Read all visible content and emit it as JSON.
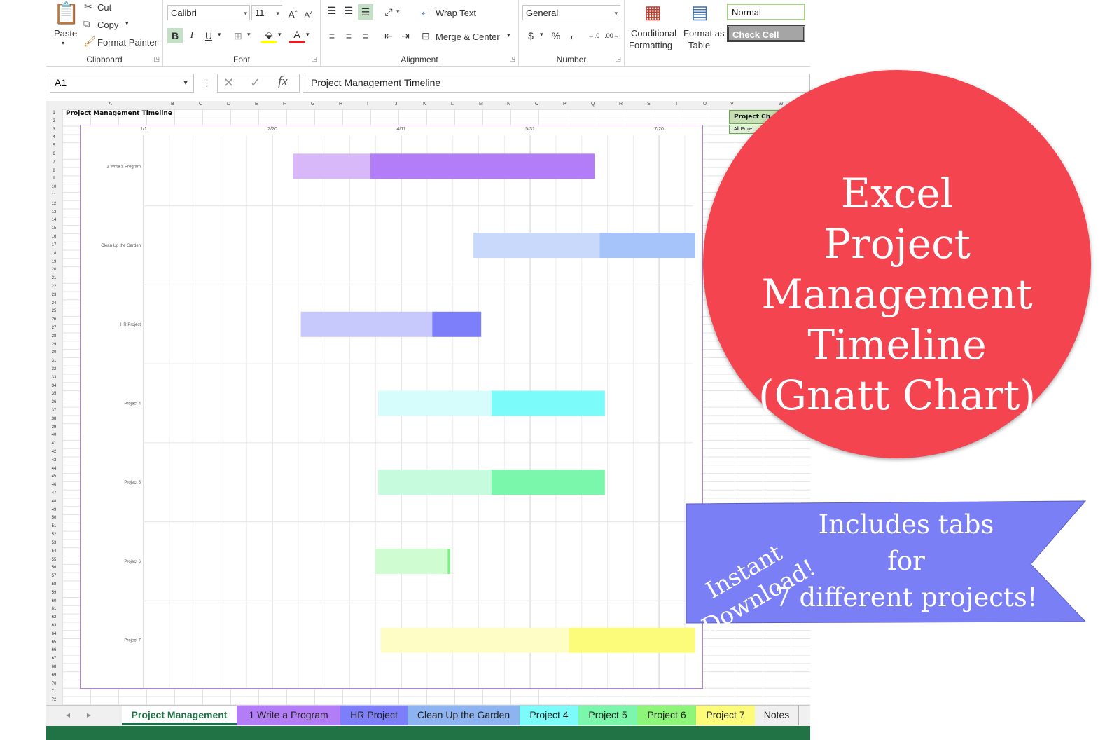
{
  "ribbon": {
    "clipboard": {
      "paste": "Paste",
      "cut": "Cut",
      "copy": "Copy",
      "format_painter": "Format Painter",
      "label": "Clipboard"
    },
    "font": {
      "name": "Calibri",
      "size": "11",
      "bold": "B",
      "italic": "I",
      "underline": "U",
      "label": "Font"
    },
    "alignment": {
      "wrap_text": "Wrap Text",
      "merge_center": "Merge & Center",
      "label": "Alignment"
    },
    "number": {
      "format": "General",
      "currency": "$",
      "percent": "%",
      "comma": ",",
      "label": "Number"
    },
    "styles": {
      "conditional": "Conditional",
      "formatting": "Formatting",
      "format_as": "Format as",
      "table": "Table",
      "normal": "Normal",
      "check_cell": "Check Cell"
    }
  },
  "formula_bar": {
    "name_box": "A1",
    "fx": "fx",
    "content": "Project Management Timeline"
  },
  "sheet": {
    "a1": "Project Management Timeline",
    "columns": [
      "A",
      "B",
      "C",
      "D",
      "E",
      "F",
      "G",
      "H",
      "I",
      "J",
      "K",
      "L",
      "M",
      "N",
      "O",
      "P",
      "Q",
      "R",
      "S",
      "T",
      "U",
      "V",
      "W"
    ],
    "row_count": 72,
    "pivot_header": "Project Ch",
    "pivot_sub": "All Proje"
  },
  "chart_data": {
    "type": "bar",
    "orientation": "horizontal-stacked-gantt",
    "x_ticks": [
      "1/1",
      "2/20",
      "4/11",
      "5/31",
      "7/20"
    ],
    "categories": [
      "1 Write a Program",
      "Clean Up the Garden",
      "HR Project",
      "Project 4",
      "Project 5",
      "Project 6",
      "Project 7"
    ],
    "start_days": [
      58,
      128,
      61,
      91,
      91,
      90,
      92
    ],
    "segment1_days": [
      30,
      49,
      51,
      44,
      44,
      28,
      73
    ],
    "segment2_days": [
      87,
      37,
      19,
      44,
      44,
      1,
      49
    ],
    "colors_light": [
      "#d8b8f8",
      "#c9d9fb",
      "#c7c8fb",
      "#d6fdfc",
      "#c6fcdd",
      "#cffdd1",
      "#fdfdc5"
    ],
    "colors_dark": [
      "#b37df8",
      "#a6c4fa",
      "#7c7ff9",
      "#7bfbf9",
      "#7bf7ac",
      "#7cf181",
      "#fcfc7a"
    ],
    "xlim": [
      0,
      213
    ],
    "grid": true
  },
  "tabs": [
    {
      "label": "Project Management",
      "color": "#ffffff",
      "active": true
    },
    {
      "label": "1 Write a Program",
      "color": "#b37df8"
    },
    {
      "label": "HR Project",
      "color": "#7c7ff9"
    },
    {
      "label": "Clean Up the Garden",
      "color": "#8db4f0"
    },
    {
      "label": "Project 4",
      "color": "#7bfbf9"
    },
    {
      "label": "Project 5",
      "color": "#7bf7ac"
    },
    {
      "label": "Project 6",
      "color": "#8df578"
    },
    {
      "label": "Project 7",
      "color": "#fcfc7a"
    },
    {
      "label": "Notes",
      "color": "#f0f0f0"
    }
  ],
  "promo": {
    "circle_lines": [
      "Excel",
      "Project Management",
      "Timeline",
      "(Gnatt Chart)"
    ],
    "circle_color": "#f34450",
    "banner_lines": [
      "Includes tabs",
      "for",
      "7 different projects!"
    ],
    "banner_color": "#7b7ff5",
    "instant_lines": [
      "Instant",
      "Download!"
    ]
  }
}
